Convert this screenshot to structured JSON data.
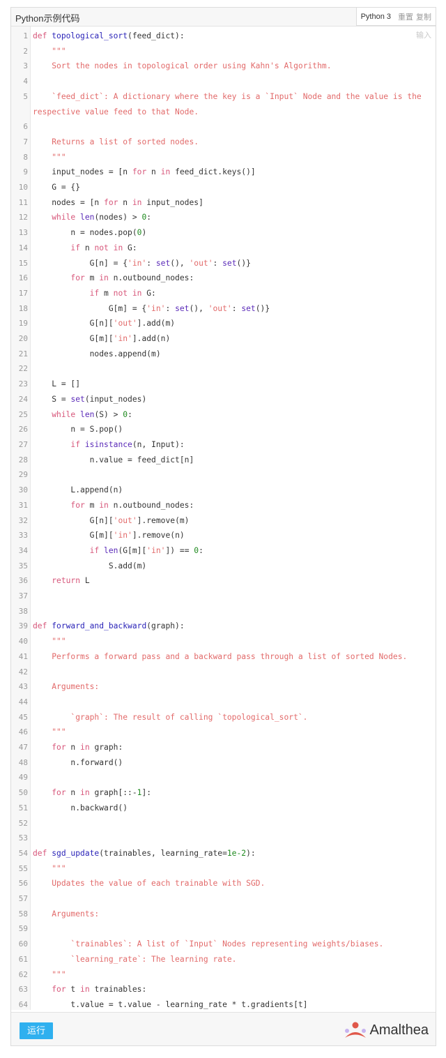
{
  "header": {
    "title": "Python示例代码",
    "language": "Python 3",
    "reset_label": "重置",
    "copy_label": "复制"
  },
  "editor": {
    "input_hint": "输入",
    "lines": [
      {
        "n": "1",
        "tokens": [
          [
            "kw",
            "def "
          ],
          [
            "fn",
            "topological_sort"
          ],
          [
            "",
            "(feed_dict):"
          ]
        ]
      },
      {
        "n": "2",
        "tokens": [
          [
            "doc",
            "    \"\"\""
          ]
        ]
      },
      {
        "n": "3",
        "tokens": [
          [
            "doc",
            "    Sort the nodes in topological order using Kahn's Algorithm."
          ]
        ]
      },
      {
        "n": "4",
        "tokens": [
          [
            "",
            ""
          ]
        ]
      },
      {
        "n": "5",
        "tokens": [
          [
            "doc",
            "    `feed_dict`: A dictionary where the key is a `Input` Node and the value is the respective value feed to that Node."
          ]
        ]
      },
      {
        "n": "6",
        "tokens": [
          [
            "",
            ""
          ]
        ]
      },
      {
        "n": "7",
        "tokens": [
          [
            "doc",
            "    Returns a list of sorted nodes."
          ]
        ]
      },
      {
        "n": "8",
        "tokens": [
          [
            "doc",
            "    \"\"\""
          ]
        ]
      },
      {
        "n": "9",
        "tokens": [
          [
            "",
            "    input_nodes = [n "
          ],
          [
            "kw",
            "for"
          ],
          [
            "",
            " n "
          ],
          [
            "kw",
            "in"
          ],
          [
            "",
            " feed_dict.keys()]"
          ]
        ]
      },
      {
        "n": "10",
        "tokens": [
          [
            "",
            "    G = {}"
          ]
        ]
      },
      {
        "n": "11",
        "tokens": [
          [
            "",
            "    nodes = [n "
          ],
          [
            "kw",
            "for"
          ],
          [
            "",
            " n "
          ],
          [
            "kw",
            "in"
          ],
          [
            "",
            " input_nodes]"
          ]
        ]
      },
      {
        "n": "12",
        "tokens": [
          [
            "kw",
            "    while"
          ],
          [
            "",
            " "
          ],
          [
            "bi",
            "len"
          ],
          [
            "",
            "(nodes) > "
          ],
          [
            "num",
            "0"
          ],
          [
            "",
            ":"
          ]
        ]
      },
      {
        "n": "13",
        "tokens": [
          [
            "",
            "        n = nodes.pop("
          ],
          [
            "num",
            "0"
          ],
          [
            "",
            ")"
          ]
        ]
      },
      {
        "n": "14",
        "tokens": [
          [
            "kw",
            "        if"
          ],
          [
            "",
            " n "
          ],
          [
            "kw",
            "not in"
          ],
          [
            "",
            " G:"
          ]
        ]
      },
      {
        "n": "15",
        "tokens": [
          [
            "",
            "            G[n] = {"
          ],
          [
            "str",
            "'in'"
          ],
          [
            "",
            ": "
          ],
          [
            "bi",
            "set"
          ],
          [
            "",
            "(), "
          ],
          [
            "str",
            "'out'"
          ],
          [
            "",
            ": "
          ],
          [
            "bi",
            "set"
          ],
          [
            "",
            "()}"
          ]
        ]
      },
      {
        "n": "16",
        "tokens": [
          [
            "kw",
            "        for"
          ],
          [
            "",
            " m "
          ],
          [
            "kw",
            "in"
          ],
          [
            "",
            " n.outbound_nodes:"
          ]
        ]
      },
      {
        "n": "17",
        "tokens": [
          [
            "kw",
            "            if"
          ],
          [
            "",
            " m "
          ],
          [
            "kw",
            "not in"
          ],
          [
            "",
            " G:"
          ]
        ]
      },
      {
        "n": "18",
        "tokens": [
          [
            "",
            "                G[m] = {"
          ],
          [
            "str",
            "'in'"
          ],
          [
            "",
            ": "
          ],
          [
            "bi",
            "set"
          ],
          [
            "",
            "(), "
          ],
          [
            "str",
            "'out'"
          ],
          [
            "",
            ": "
          ],
          [
            "bi",
            "set"
          ],
          [
            "",
            "()}"
          ]
        ]
      },
      {
        "n": "19",
        "tokens": [
          [
            "",
            "            G[n]["
          ],
          [
            "str",
            "'out'"
          ],
          [
            "",
            "].add(m)"
          ]
        ]
      },
      {
        "n": "20",
        "tokens": [
          [
            "",
            "            G[m]["
          ],
          [
            "str",
            "'in'"
          ],
          [
            "",
            "].add(n)"
          ]
        ]
      },
      {
        "n": "21",
        "tokens": [
          [
            "",
            "            nodes.append(m)"
          ]
        ]
      },
      {
        "n": "22",
        "tokens": [
          [
            "",
            ""
          ]
        ]
      },
      {
        "n": "23",
        "tokens": [
          [
            "",
            "    L = []"
          ]
        ]
      },
      {
        "n": "24",
        "tokens": [
          [
            "",
            "    S = "
          ],
          [
            "bi",
            "set"
          ],
          [
            "",
            "(input_nodes)"
          ]
        ]
      },
      {
        "n": "25",
        "tokens": [
          [
            "kw",
            "    while"
          ],
          [
            "",
            " "
          ],
          [
            "bi",
            "len"
          ],
          [
            "",
            "(S) > "
          ],
          [
            "num",
            "0"
          ],
          [
            "",
            ":"
          ]
        ]
      },
      {
        "n": "26",
        "tokens": [
          [
            "",
            "        n = S.pop()"
          ]
        ]
      },
      {
        "n": "27",
        "tokens": [
          [
            "kw",
            "        if"
          ],
          [
            "",
            " "
          ],
          [
            "bi",
            "isinstance"
          ],
          [
            "",
            "(n, Input):"
          ]
        ]
      },
      {
        "n": "28",
        "tokens": [
          [
            "",
            "            n.value = feed_dict[n]"
          ]
        ]
      },
      {
        "n": "29",
        "tokens": [
          [
            "",
            ""
          ]
        ]
      },
      {
        "n": "30",
        "tokens": [
          [
            "",
            "        L.append(n)"
          ]
        ]
      },
      {
        "n": "31",
        "tokens": [
          [
            "kw",
            "        for"
          ],
          [
            "",
            " m "
          ],
          [
            "kw",
            "in"
          ],
          [
            "",
            " n.outbound_nodes:"
          ]
        ]
      },
      {
        "n": "32",
        "tokens": [
          [
            "",
            "            G[n]["
          ],
          [
            "str",
            "'out'"
          ],
          [
            "",
            "].remove(m)"
          ]
        ]
      },
      {
        "n": "33",
        "tokens": [
          [
            "",
            "            G[m]["
          ],
          [
            "str",
            "'in'"
          ],
          [
            "",
            "].remove(n)"
          ]
        ]
      },
      {
        "n": "34",
        "tokens": [
          [
            "kw",
            "            if"
          ],
          [
            "",
            " "
          ],
          [
            "bi",
            "len"
          ],
          [
            "",
            "(G[m]["
          ],
          [
            "str",
            "'in'"
          ],
          [
            "",
            "]) == "
          ],
          [
            "num",
            "0"
          ],
          [
            "",
            ":"
          ]
        ]
      },
      {
        "n": "35",
        "tokens": [
          [
            "",
            "                S.add(m)"
          ]
        ]
      },
      {
        "n": "36",
        "tokens": [
          [
            "kw",
            "    return"
          ],
          [
            "",
            " L"
          ]
        ]
      },
      {
        "n": "37",
        "tokens": [
          [
            "",
            ""
          ]
        ]
      },
      {
        "n": "38",
        "tokens": [
          [
            "",
            ""
          ]
        ]
      },
      {
        "n": "39",
        "tokens": [
          [
            "kw",
            "def "
          ],
          [
            "fn",
            "forward_and_backward"
          ],
          [
            "",
            "(graph):"
          ]
        ]
      },
      {
        "n": "40",
        "tokens": [
          [
            "doc",
            "    \"\"\""
          ]
        ]
      },
      {
        "n": "41",
        "tokens": [
          [
            "doc",
            "    Performs a forward pass and a backward pass through a list of sorted Nodes."
          ]
        ]
      },
      {
        "n": "42",
        "tokens": [
          [
            "",
            ""
          ]
        ]
      },
      {
        "n": "43",
        "tokens": [
          [
            "doc",
            "    Arguments:"
          ]
        ]
      },
      {
        "n": "44",
        "tokens": [
          [
            "",
            ""
          ]
        ]
      },
      {
        "n": "45",
        "tokens": [
          [
            "doc",
            "        `graph`: The result of calling `topological_sort`."
          ]
        ]
      },
      {
        "n": "46",
        "tokens": [
          [
            "doc",
            "    \"\"\""
          ]
        ]
      },
      {
        "n": "47",
        "tokens": [
          [
            "kw",
            "    for"
          ],
          [
            "",
            " n "
          ],
          [
            "kw",
            "in"
          ],
          [
            "",
            " graph:"
          ]
        ]
      },
      {
        "n": "48",
        "tokens": [
          [
            "",
            "        n.forward()"
          ]
        ]
      },
      {
        "n": "49",
        "tokens": [
          [
            "",
            ""
          ]
        ]
      },
      {
        "n": "50",
        "tokens": [
          [
            "kw",
            "    for"
          ],
          [
            "",
            " n "
          ],
          [
            "kw",
            "in"
          ],
          [
            "",
            " graph[::-"
          ],
          [
            "num",
            "1"
          ],
          [
            "",
            "]:"
          ]
        ]
      },
      {
        "n": "51",
        "tokens": [
          [
            "",
            "        n.backward()"
          ]
        ]
      },
      {
        "n": "52",
        "tokens": [
          [
            "",
            ""
          ]
        ]
      },
      {
        "n": "53",
        "tokens": [
          [
            "",
            ""
          ]
        ]
      },
      {
        "n": "54",
        "tokens": [
          [
            "kw",
            "def "
          ],
          [
            "fn",
            "sgd_update"
          ],
          [
            "",
            "(trainables, learning_rate="
          ],
          [
            "num",
            "1e-2"
          ],
          [
            "",
            "):"
          ]
        ]
      },
      {
        "n": "55",
        "tokens": [
          [
            "doc",
            "    \"\"\""
          ]
        ]
      },
      {
        "n": "56",
        "tokens": [
          [
            "doc",
            "    Updates the value of each trainable with SGD."
          ]
        ]
      },
      {
        "n": "57",
        "tokens": [
          [
            "",
            ""
          ]
        ]
      },
      {
        "n": "58",
        "tokens": [
          [
            "doc",
            "    Arguments:"
          ]
        ]
      },
      {
        "n": "59",
        "tokens": [
          [
            "",
            ""
          ]
        ]
      },
      {
        "n": "60",
        "tokens": [
          [
            "doc",
            "        `trainables`: A list of `Input` Nodes representing weights/biases."
          ]
        ]
      },
      {
        "n": "61",
        "tokens": [
          [
            "doc",
            "        `learning_rate`: The learning rate."
          ]
        ]
      },
      {
        "n": "62",
        "tokens": [
          [
            "doc",
            "    \"\"\""
          ]
        ]
      },
      {
        "n": "63",
        "tokens": [
          [
            "kw",
            "    for"
          ],
          [
            "",
            " t "
          ],
          [
            "kw",
            "in"
          ],
          [
            "",
            " trainables:"
          ]
        ]
      },
      {
        "n": "64",
        "tokens": [
          [
            "",
            "        t.value = t.value - learning_rate * t.gradients[t]"
          ]
        ]
      }
    ]
  },
  "footer": {
    "run_label": "运行",
    "brand_name": "Amalthea"
  },
  "colors": {
    "run_button": "#2fb0ef",
    "keyword": "#d7567a",
    "function_name": "#2a23b8",
    "builtin": "#5a2ab8",
    "string": "#e26a6a",
    "number": "#1f8a1f",
    "logo_red": "#e0584a",
    "logo_purple": "#c7b3f0"
  }
}
